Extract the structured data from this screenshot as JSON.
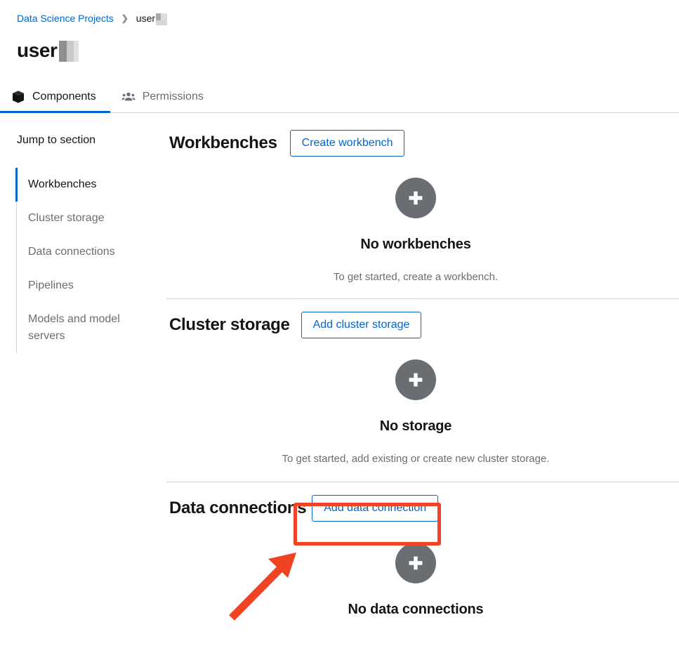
{
  "breadcrumb": {
    "root_label": "Data Science Projects",
    "separator": "›",
    "current_label": "user",
    "current_redacted": true
  },
  "page": {
    "title": "user",
    "title_redacted": true
  },
  "tabs": [
    {
      "label": "Components",
      "icon": "cube-icon",
      "active": true
    },
    {
      "label": "Permissions",
      "icon": "users-icon",
      "active": false
    }
  ],
  "jump_to_section": {
    "title": "Jump to section",
    "items": [
      {
        "label": "Workbenches",
        "active": true
      },
      {
        "label": "Cluster storage",
        "active": false
      },
      {
        "label": "Data connections",
        "active": false
      },
      {
        "label": "Pipelines",
        "active": false
      },
      {
        "label": "Models and model servers",
        "active": false
      }
    ]
  },
  "sections": {
    "workbenches": {
      "title": "Workbenches",
      "action_label": "Create workbench",
      "empty": {
        "icon": "plus-circle-icon",
        "title": "No workbenches",
        "body": "To get started, create a workbench."
      }
    },
    "cluster_storage": {
      "title": "Cluster storage",
      "action_label": "Add cluster storage",
      "empty": {
        "icon": "plus-circle-icon",
        "title": "No storage",
        "body": "To get started, add existing or create new cluster storage."
      }
    },
    "data_connections": {
      "title": "Data connections",
      "action_label": "Add data connection",
      "empty": {
        "icon": "plus-circle-icon",
        "title": "No data connections",
        "body": ""
      }
    }
  },
  "annotation": {
    "highlight_target": "Add data connection",
    "color": "#ef4323",
    "shapes": [
      "rectangle",
      "arrow"
    ]
  },
  "colors": {
    "accent_blue": "#0066cc",
    "text_primary": "#151515",
    "text_muted": "#6a6e73",
    "border": "#d2d2d2",
    "annotation": "#ef4323",
    "empty_icon_bg": "#6a6e73"
  }
}
